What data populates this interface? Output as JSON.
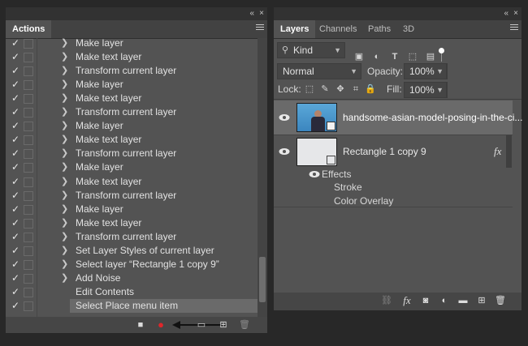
{
  "window_controls": {
    "collapse": "«",
    "close": "×"
  },
  "actions_panel": {
    "tab": "Actions",
    "rows": [
      {
        "check": "✓",
        "chevron": "❯",
        "label": "Make layer"
      },
      {
        "check": "✓",
        "chevron": "❯",
        "label": "Make text layer"
      },
      {
        "check": "✓",
        "chevron": "❯",
        "label": "Transform current layer"
      },
      {
        "check": "✓",
        "chevron": "❯",
        "label": "Make layer"
      },
      {
        "check": "✓",
        "chevron": "❯",
        "label": "Make text layer"
      },
      {
        "check": "✓",
        "chevron": "❯",
        "label": "Transform current layer"
      },
      {
        "check": "✓",
        "chevron": "❯",
        "label": "Make layer"
      },
      {
        "check": "✓",
        "chevron": "❯",
        "label": "Make text layer"
      },
      {
        "check": "✓",
        "chevron": "❯",
        "label": "Transform current layer"
      },
      {
        "check": "✓",
        "chevron": "❯",
        "label": "Make layer"
      },
      {
        "check": "✓",
        "chevron": "❯",
        "label": "Make text layer"
      },
      {
        "check": "✓",
        "chevron": "❯",
        "label": "Transform current layer"
      },
      {
        "check": "✓",
        "chevron": "❯",
        "label": "Make layer"
      },
      {
        "check": "✓",
        "chevron": "❯",
        "label": "Make text layer"
      },
      {
        "check": "✓",
        "chevron": "❯",
        "label": "Transform current layer"
      },
      {
        "check": "✓",
        "chevron": "❯",
        "label": "Set Layer Styles of current layer"
      },
      {
        "check": "✓",
        "chevron": "❯",
        "label": "Select layer “Rectangle 1 copy 9”"
      },
      {
        "check": "✓",
        "chevron": "❯",
        "label": "Add Noise"
      },
      {
        "check": "✓",
        "chevron": "",
        "label": "Edit Contents"
      },
      {
        "check": "✓",
        "chevron": "",
        "label": "Select Place menu item"
      }
    ],
    "toolbar": {
      "stop": "■",
      "record": "●",
      "play": "▶",
      "new_set": "▭",
      "new_action": "⊞",
      "delete": "🗑"
    }
  },
  "layers_panel": {
    "tabs": [
      "Layers",
      "Channels",
      "Paths",
      "3D"
    ],
    "kind_label": "Kind",
    "blend_mode": "Normal",
    "opacity_label": "Opacity:",
    "opacity_value": "100%",
    "lock_label": "Lock:",
    "fill_label": "Fill:",
    "fill_value": "100%",
    "layers": [
      {
        "name": "handsome-asian-model-posing-in-the-ci..."
      },
      {
        "name": "Rectangle 1 copy 9",
        "fx": "fx"
      }
    ],
    "effects_label": "Effects",
    "effects": [
      "Stroke",
      "Color Overlay"
    ],
    "bottom_icons": {
      "link": "⛓",
      "fx": "fx",
      "mask": "◙",
      "adjust": "◐",
      "group": "▬",
      "new": "⊞",
      "delete": "🗑"
    }
  },
  "colors": {
    "record_red": "#e0262a",
    "accent_white": "#ffffff"
  }
}
